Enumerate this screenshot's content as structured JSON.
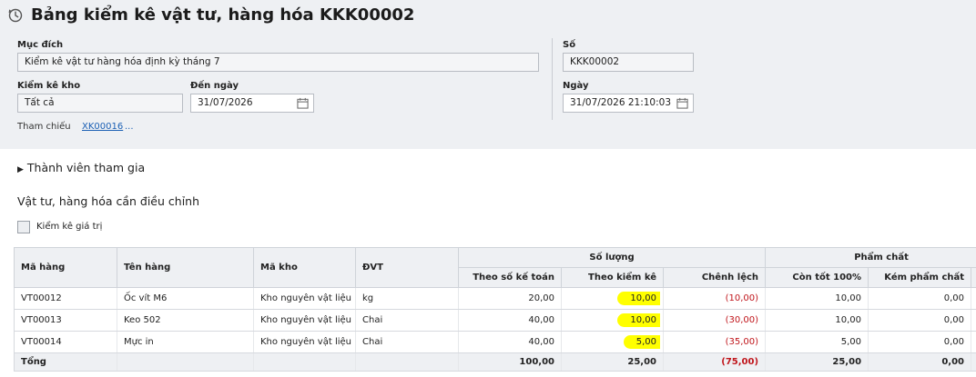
{
  "header": {
    "title": "Bảng kiểm kê vật tư, hàng hóa KKK00002",
    "icon": "history-clock-icon"
  },
  "form": {
    "purpose_label": "Mục đích",
    "purpose_value": "Kiểm kê vật tư hàng hóa định kỳ tháng 7",
    "number_label": "Số",
    "number_value": "KKK00002",
    "warehouse_label": "Kiểm kê kho",
    "warehouse_value": "Tất cả",
    "to_date_label": "Đến ngày",
    "to_date_value": "31/07/2026",
    "date_label": "Ngày",
    "date_value": "31/07/2026 21:10:03",
    "reference_label": "Tham chiếu",
    "reference_link": "XK00016",
    "reference_more": "..."
  },
  "members": {
    "toggle_label": "Thành viên tham gia"
  },
  "adjust": {
    "title": "Vật tư, hàng hóa cần điều chỉnh",
    "checkbox_label": "Kiểm kê giá trị"
  },
  "table": {
    "columns": {
      "code": "Mã hàng",
      "name": "Tên hàng",
      "warehouse": "Mã kho",
      "unit": "ĐVT",
      "quantity_group": "Số lượng",
      "book_qty": "Theo số kế toán",
      "counted_qty": "Theo kiểm kê",
      "difference": "Chênh lệch",
      "quality_group": "Phẩm chất",
      "good": "Còn tốt 100%",
      "poor": "Kém phẩm chất"
    },
    "rows": [
      {
        "code": "VT00012",
        "name": "Ốc vít M6",
        "warehouse": "Kho nguyên vật liệu",
        "unit": "kg",
        "book_qty": "20,00",
        "counted_qty": "10,00",
        "difference": "(10,00)",
        "good": "10,00",
        "poor": "0,00"
      },
      {
        "code": "VT00013",
        "name": "Keo 502",
        "warehouse": "Kho nguyên vật liệu",
        "unit": "Chai",
        "book_qty": "40,00",
        "counted_qty": "10,00",
        "difference": "(30,00)",
        "good": "10,00",
        "poor": "0,00"
      },
      {
        "code": "VT00014",
        "name": "Mực in",
        "warehouse": "Kho nguyên vật liệu",
        "unit": "Chai",
        "book_qty": "40,00",
        "counted_qty": "5,00",
        "difference": "(35,00)",
        "good": "5,00",
        "poor": "0,00"
      }
    ],
    "total": {
      "label": "Tổng",
      "book_qty": "100,00",
      "counted_qty": "25,00",
      "difference": "(75,00)",
      "good": "25,00",
      "poor": "0,00"
    }
  },
  "colors": {
    "panel_bg": "#eef0f3",
    "link": "#1a5fb4",
    "negative": "#c0151b",
    "highlight": "#ffff00"
  }
}
